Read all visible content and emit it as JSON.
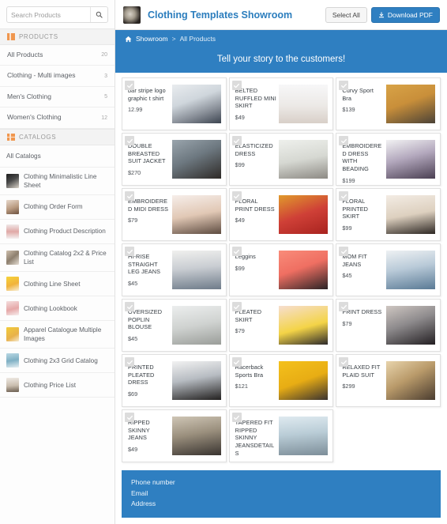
{
  "search": {
    "placeholder": "Search Products",
    "value": "",
    "icon": "search-icon"
  },
  "sidebar": {
    "products_section": {
      "label": "PRODUCTS",
      "icon": "columns-icon"
    },
    "products": [
      {
        "label": "All Products",
        "count": "20"
      },
      {
        "label": "Clothing - Multi images",
        "count": "3"
      },
      {
        "label": "Men's Clothing",
        "count": "5"
      },
      {
        "label": "Women's Clothing",
        "count": "12"
      }
    ],
    "catalogs_section": {
      "label": "CATALOGS",
      "icon": "grid-icon"
    },
    "catalogs": [
      {
        "label": "All Catalogs",
        "has_thumb": false
      },
      {
        "label": "Clothing Minimalistic Line Sheet",
        "has_thumb": true
      },
      {
        "label": "Clothing Order Form",
        "has_thumb": true
      },
      {
        "label": "Clothing Product Description",
        "has_thumb": true
      },
      {
        "label": "Clothing Catalog 2x2 & Price List",
        "has_thumb": true
      },
      {
        "label": "Clothing Line Sheet",
        "has_thumb": true
      },
      {
        "label": "Clothing Lookbook",
        "has_thumb": true
      },
      {
        "label": "Apparel Catalogue Multiple Images",
        "has_thumb": true
      },
      {
        "label": "Clothing 2x3 Grid Catalog",
        "has_thumb": true
      },
      {
        "label": "Clothing Price List",
        "has_thumb": true
      }
    ]
  },
  "header": {
    "logo": "showroom-logo",
    "title": "Clothing Templates Showroom",
    "select_all_label": "Select All",
    "download_label": "Download PDF",
    "download_icon": "download-icon"
  },
  "breadcrumb": {
    "home_icon": "home-icon",
    "root": "Showroom",
    "separator": ">",
    "current": "All Products"
  },
  "banner": {
    "text": "Tell your story to the customers!"
  },
  "products": [
    {
      "title": "bar stripe logo graphic t shirt",
      "price": "12.99",
      "uppercase": false
    },
    {
      "title": "BELTED RUFFLED MINI SKIRT",
      "price": "$49",
      "uppercase": true
    },
    {
      "title": "Curvy Sport Bra",
      "price": "$139",
      "uppercase": false
    },
    {
      "title": "DOUBLE BREASTED SUIT JACKET",
      "price": "$270",
      "uppercase": true
    },
    {
      "title": "ELASTICIZED DRESS",
      "price": "$99",
      "uppercase": true
    },
    {
      "title": "EMBROIDERED DRESS WITH BEADING",
      "price": "$199",
      "uppercase": true
    },
    {
      "title": "EMBROIDERED MIDI DRESS",
      "price": "$79",
      "uppercase": true
    },
    {
      "title": "FLORAL PRINT DRESS",
      "price": "$49",
      "uppercase": true
    },
    {
      "title": "FLORAL PRINTED SKIRT",
      "price": "$99",
      "uppercase": true
    },
    {
      "title": "HI-RISE STRAIGHT LEG JEANS",
      "price": "$45",
      "uppercase": true
    },
    {
      "title": "Leggins",
      "price": "$99",
      "uppercase": false
    },
    {
      "title": "MOM FIT JEANS",
      "price": "$45",
      "uppercase": true
    },
    {
      "title": "OVERSIZED POPLIN BLOUSE",
      "price": "$45",
      "uppercase": true
    },
    {
      "title": "PLEATED SKIRT",
      "price": "$79",
      "uppercase": true
    },
    {
      "title": "PRINT DRESS",
      "price": "$79",
      "uppercase": true
    },
    {
      "title": "PRINTED PLEATED DRESS",
      "price": "$69",
      "uppercase": true
    },
    {
      "title": "Racerback Sports Bra",
      "price": "$121",
      "uppercase": false
    },
    {
      "title": "RELAXED FIT PLAID SUIT",
      "price": "$299",
      "uppercase": true
    },
    {
      "title": "RIPPED SKINNY JEANS",
      "price": "$49",
      "uppercase": true
    },
    {
      "title": "TAPERED FIT RIPPED SKINNY JEANSDETAILS",
      "price": "$49",
      "uppercase": true
    }
  ],
  "footer": {
    "line1": "Phone number",
    "line2": "Email",
    "line3": "Address"
  },
  "colors": {
    "accent": "#2f7fc1",
    "brand_text": "#2b7dbd",
    "section_icon": "#f0974f"
  }
}
